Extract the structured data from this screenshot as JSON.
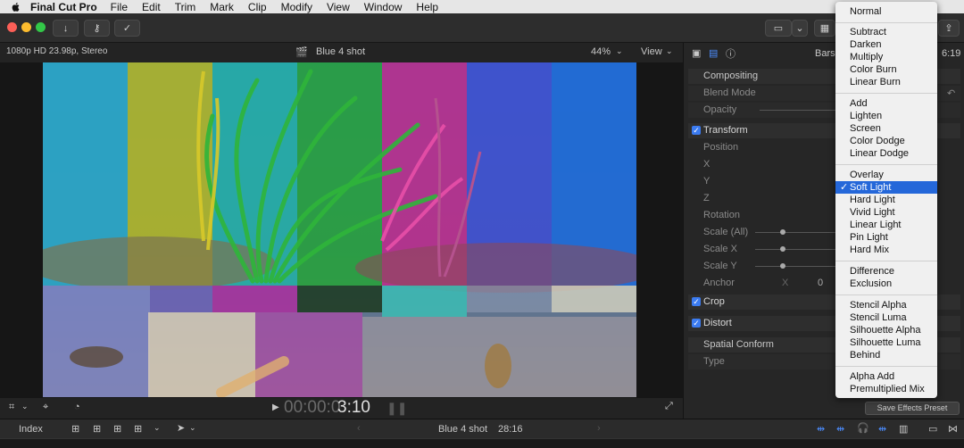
{
  "menubar": {
    "app": "Final Cut Pro",
    "items": [
      "File",
      "Edit",
      "Trim",
      "Mark",
      "Clip",
      "Modify",
      "View",
      "Window",
      "Help"
    ]
  },
  "viewer": {
    "format": "1080p HD 23.98p, Stereo",
    "clip_name": "Blue 4 shot",
    "zoom": "44%",
    "view_label": "View",
    "timecode_dim": "00:00:0",
    "timecode_bright": "3:10"
  },
  "inspector": {
    "title_partial": "Bars",
    "duration_partial": "6:19",
    "compositing": "Compositing",
    "blend_mode": "Blend Mode",
    "opacity": "Opacity",
    "transform": "Transform",
    "position": "Position",
    "x": "X",
    "y": "Y",
    "z": "Z",
    "rotation": "Rotation",
    "scale_all": "Scale (All)",
    "scale_x": "Scale X",
    "scale_y": "Scale Y",
    "anchor": "Anchor",
    "anchor_x": "X",
    "anchor_val": "0",
    "crop": "Crop",
    "distort": "Distort",
    "spatial_conform": "Spatial Conform",
    "type": "Type",
    "save_preset": "Save Effects Preset"
  },
  "timeline": {
    "index": "Index",
    "project": "Blue 4 shot",
    "duration": "28:16"
  },
  "blend_menu": {
    "groups": [
      [
        "Normal"
      ],
      [
        "Subtract",
        "Darken",
        "Multiply",
        "Color Burn",
        "Linear Burn"
      ],
      [
        "Add",
        "Lighten",
        "Screen",
        "Color Dodge",
        "Linear Dodge"
      ],
      [
        "Overlay",
        "Soft Light",
        "Hard Light",
        "Vivid Light",
        "Linear Light",
        "Pin Light",
        "Hard Mix"
      ],
      [
        "Difference",
        "Exclusion"
      ],
      [
        "Stencil Alpha",
        "Stencil Luma",
        "Silhouette Alpha",
        "Silhouette Luma",
        "Behind"
      ],
      [
        "Alpha Add",
        "Premultiplied Mix"
      ]
    ],
    "selected": "Soft Light"
  },
  "colors": {
    "accent": "#2467d9",
    "checkbox": "#3b7bf0"
  }
}
